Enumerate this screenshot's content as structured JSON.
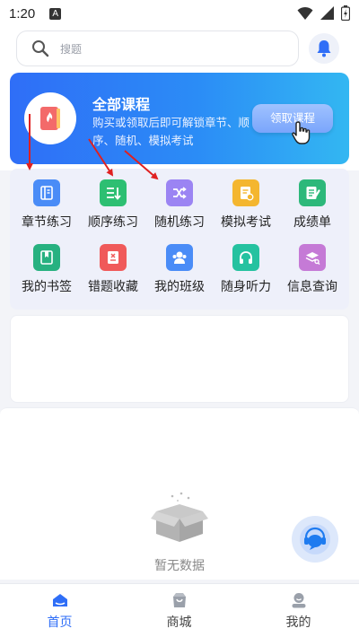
{
  "status_bar": {
    "time": "1:20",
    "notification_icon": "A"
  },
  "search": {
    "placeholder": "搜题"
  },
  "banner": {
    "title": "全部课程",
    "description": "购买或领取后即可解锁章节、顺序、随机、模拟考试",
    "button_label": "领取课程"
  },
  "grid": [
    {
      "label": "章节练习",
      "icon": "chapter-icon",
      "color": "#4a8cf7"
    },
    {
      "label": "顺序练习",
      "icon": "order-icon",
      "color": "#2dbf72"
    },
    {
      "label": "随机练习",
      "icon": "shuffle-icon",
      "color": "#9b84f3"
    },
    {
      "label": "模拟考试",
      "icon": "exam-icon",
      "color": "#f4b62f"
    },
    {
      "label": "成绩单",
      "icon": "transcript-icon",
      "color": "#2db87a"
    },
    {
      "label": "我的书签",
      "icon": "bookmark-icon",
      "color": "#27b180"
    },
    {
      "label": "错题收藏",
      "icon": "wrong-questions-icon",
      "color": "#f05a5a"
    },
    {
      "label": "我的班级",
      "icon": "class-icon",
      "color": "#4a8cf7"
    },
    {
      "label": "随身听力",
      "icon": "headphones-icon",
      "color": "#25c2a0"
    },
    {
      "label": "信息查询",
      "icon": "info-query-icon",
      "color": "#c57ad6"
    }
  ],
  "empty_state": {
    "text": "暂无数据"
  },
  "tabbar": [
    {
      "label": "首页",
      "active": true
    },
    {
      "label": "商城",
      "active": false
    },
    {
      "label": "我的",
      "active": false
    }
  ],
  "colors": {
    "accent": "#2f6ef7",
    "annotation_arrow": "#e02020"
  }
}
